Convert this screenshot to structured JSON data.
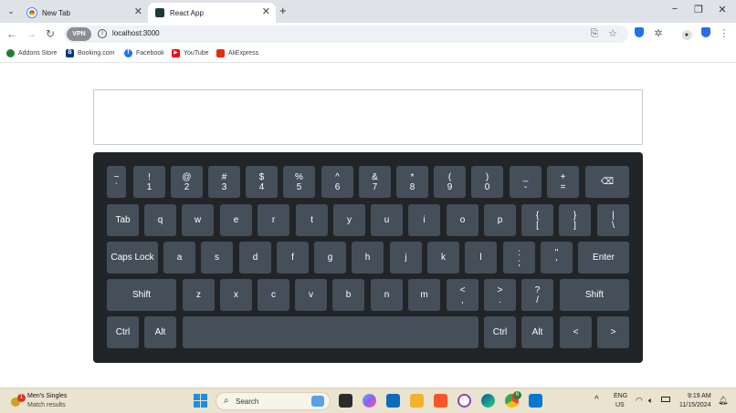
{
  "browser": {
    "tabs": [
      {
        "title": "New Tab",
        "active": false
      },
      {
        "title": "React App",
        "active": true
      }
    ],
    "url": "localhost:3000",
    "vpn_label": "VPN",
    "bookmarks": [
      "Addons Store",
      "Booking.com",
      "Facebook",
      "YouTube",
      "AliExpress"
    ]
  },
  "keyboard": {
    "rows": [
      [
        [
          "~",
          "`"
        ],
        [
          "!",
          "1"
        ],
        [
          "@",
          "2"
        ],
        [
          "#",
          "3"
        ],
        [
          "$",
          "4"
        ],
        [
          "%",
          "5"
        ],
        [
          "^",
          "6"
        ],
        [
          "&",
          "7"
        ],
        [
          "*",
          "8"
        ],
        [
          "(",
          "9"
        ],
        [
          ")",
          "0"
        ],
        [
          "_",
          "-"
        ],
        [
          "+",
          "="
        ],
        [
          "",
          "⌫"
        ]
      ],
      [
        [
          "",
          "Tab"
        ],
        [
          "",
          "q"
        ],
        [
          "",
          "w"
        ],
        [
          "",
          "e"
        ],
        [
          "",
          "r"
        ],
        [
          "",
          "t"
        ],
        [
          "",
          "y"
        ],
        [
          "",
          "u"
        ],
        [
          "",
          "i"
        ],
        [
          "",
          "o"
        ],
        [
          "",
          "p"
        ],
        [
          "{",
          "["
        ],
        [
          "}",
          "]"
        ],
        [
          "|",
          "\\"
        ]
      ],
      [
        [
          "",
          "Caps Lock"
        ],
        [
          "",
          "a"
        ],
        [
          "",
          "s"
        ],
        [
          "",
          "d"
        ],
        [
          "",
          "f"
        ],
        [
          "",
          "g"
        ],
        [
          "",
          "h"
        ],
        [
          "",
          "j"
        ],
        [
          "",
          "k"
        ],
        [
          "",
          "l"
        ],
        [
          ":",
          ";"
        ],
        [
          "\"",
          "'"
        ],
        [
          "",
          "Enter"
        ]
      ],
      [
        [
          "",
          "Shift"
        ],
        [
          "",
          "z"
        ],
        [
          "",
          "x"
        ],
        [
          "",
          "c"
        ],
        [
          "",
          "v"
        ],
        [
          "",
          "b"
        ],
        [
          "",
          "n"
        ],
        [
          "",
          "m"
        ],
        [
          "<",
          ","
        ],
        [
          ">",
          "."
        ],
        [
          "?",
          "/"
        ],
        [
          "",
          "Shift"
        ]
      ],
      [
        [
          "",
          "Ctrl"
        ],
        [
          "",
          "Alt"
        ],
        [
          "",
          ""
        ],
        [
          "",
          "Ctrl"
        ],
        [
          "",
          "Alt"
        ],
        [
          "",
          "<"
        ],
        [
          "",
          ">"
        ]
      ]
    ]
  },
  "taskbar": {
    "notification_title": "Men's Singles",
    "notification_sub": "Match results",
    "notification_badge": "1",
    "search_placeholder": "Search",
    "chrome_badge": "6",
    "lang_top": "ENG",
    "lang_bottom": "US",
    "time": "9:19 AM",
    "date": "11/15/2024"
  },
  "colors": {
    "keyboard_bg": "#222527",
    "key_bg": "#444f59",
    "key_text": "#ffffff",
    "taskbar_bg": "#e9e3cf",
    "tabstrip_bg": "#dfe3e8"
  }
}
